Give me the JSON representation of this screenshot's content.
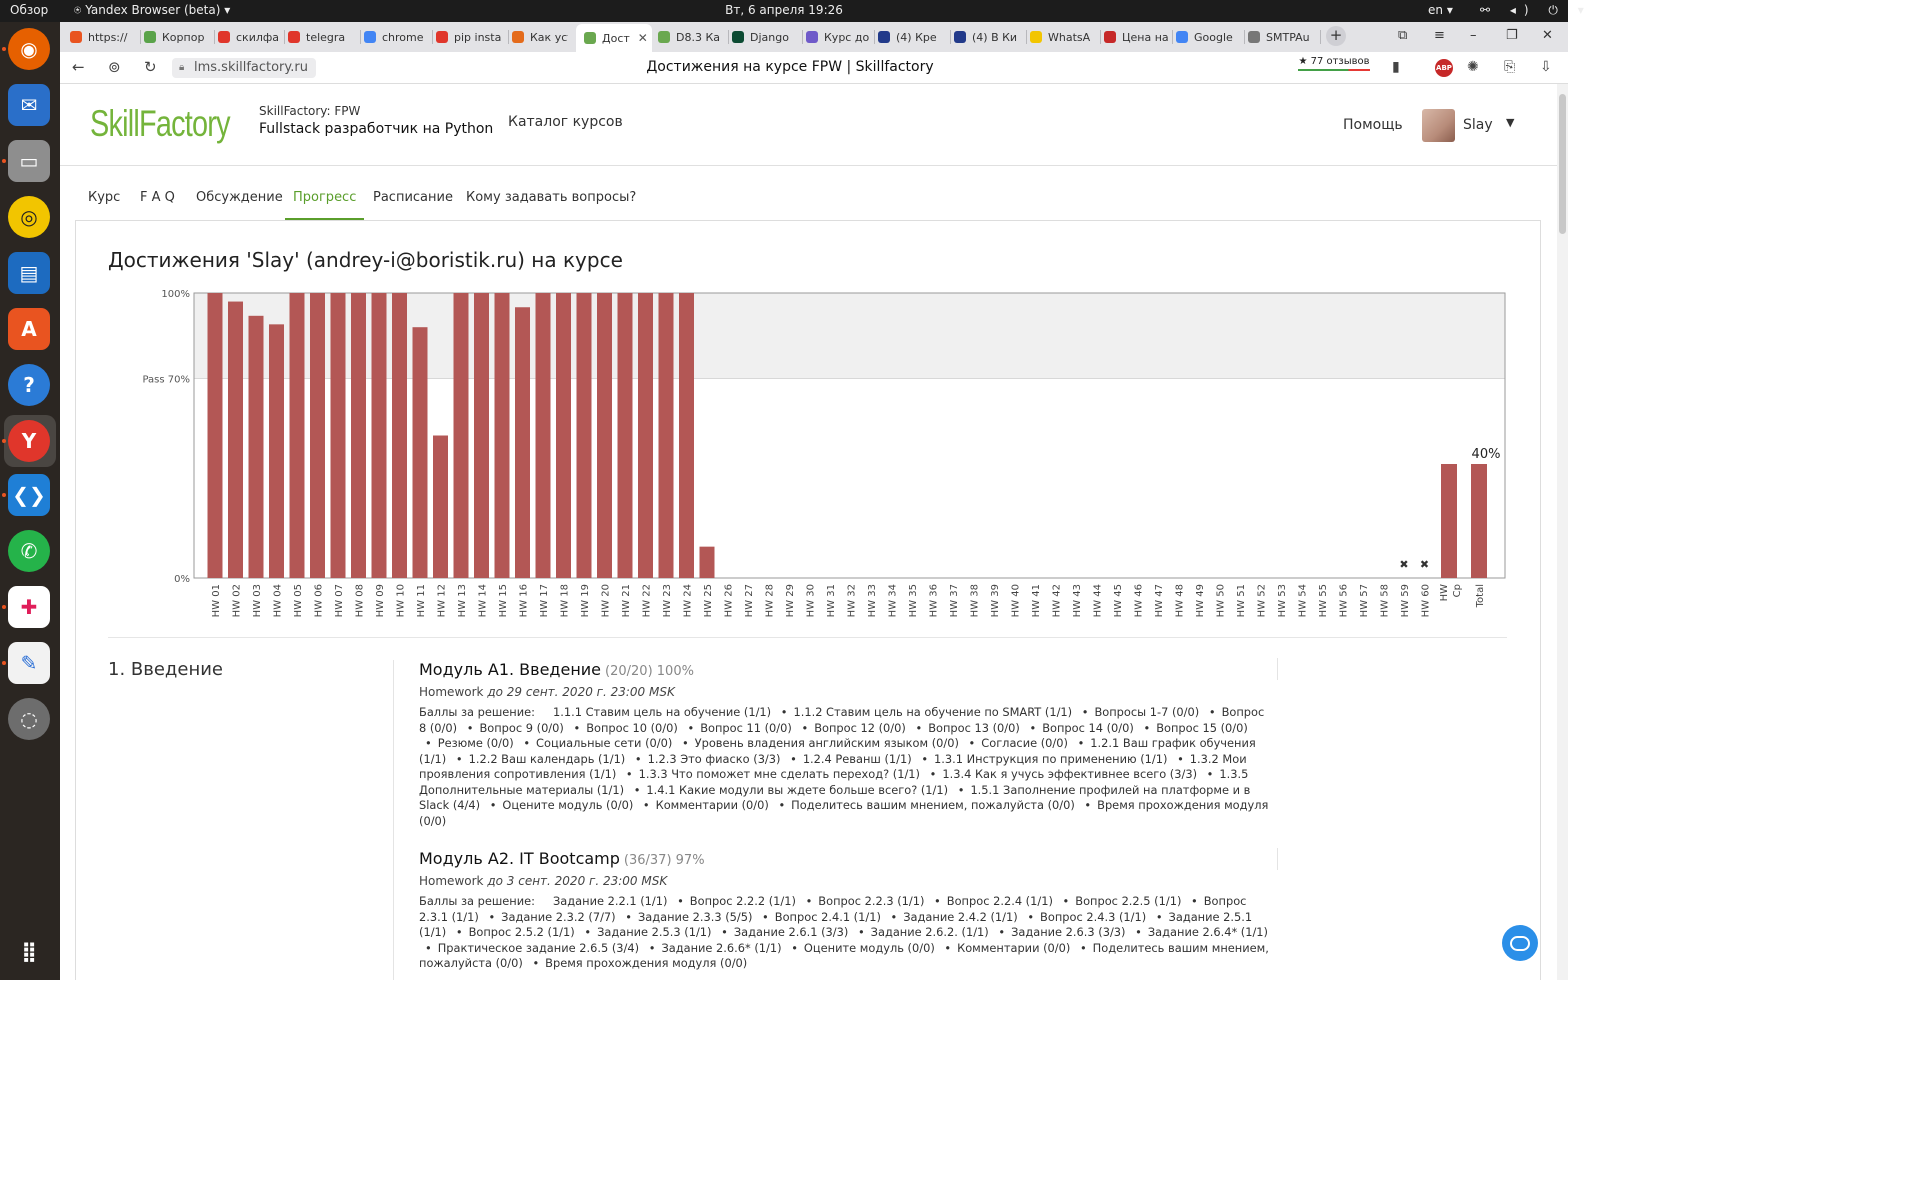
{
  "os": {
    "overview": "Обзор",
    "app_name": "Yandex Browser (beta)",
    "clock": "Вт, 6 апреля  19:26",
    "lang": "en"
  },
  "dock": [
    {
      "name": "firefox-icon",
      "color": "#e66000"
    },
    {
      "name": "thunderbird-icon",
      "color": "#2a6fc9"
    },
    {
      "name": "files-icon",
      "color": "#8e8e8e"
    },
    {
      "name": "rhythmbox-icon",
      "color": "#f2c500"
    },
    {
      "name": "writer-icon",
      "color": "#1d6bc0"
    },
    {
      "name": "software-icon",
      "color": "#e95420"
    },
    {
      "name": "help-icon",
      "color": "#2b7bd6"
    },
    {
      "name": "yandex-browser-icon",
      "color": "#e0362b"
    },
    {
      "name": "vscode-icon",
      "color": "#1f7fd6"
    },
    {
      "name": "whatsapp-icon",
      "color": "#25b34a"
    },
    {
      "name": "slack-icon",
      "color": "#ffffff"
    },
    {
      "name": "text-editor-icon",
      "color": "#f2f2f2"
    },
    {
      "name": "disks-icon",
      "color": "#6d6d6d"
    },
    {
      "name": "apps-grid-icon",
      "color": "#2b2622"
    }
  ],
  "tabs": [
    {
      "label": "https://",
      "color": "#e95420"
    },
    {
      "label": "Корпор",
      "color": "#5aa34a"
    },
    {
      "label": "скилфа",
      "color": "#e0362b"
    },
    {
      "label": "telegra",
      "color": "#e0362b"
    },
    {
      "label": "chrome",
      "color": "#4285f4"
    },
    {
      "label": "pip insta",
      "color": "#e0362b"
    },
    {
      "label": "Как уста",
      "color": "#e46b1b"
    },
    {
      "label": "Дост",
      "color": "#6aa84f"
    },
    {
      "label": "D8.3 Ка",
      "color": "#6aa84f"
    },
    {
      "label": "Django",
      "color": "#0c4b33"
    },
    {
      "label": "Курс до",
      "color": "#6f5ac9"
    },
    {
      "label": "(4) Кре",
      "color": "#223a8a"
    },
    {
      "label": "(4) В Ки",
      "color": "#223a8a"
    },
    {
      "label": "WhatsA",
      "color": "#f2c500"
    },
    {
      "label": "Цена на",
      "color": "#c62828"
    },
    {
      "label": "Google",
      "color": "#4285f4"
    },
    {
      "label": "SMTPAu",
      "color": "#777777"
    }
  ],
  "address": {
    "url": "lms.skillfactory.ru",
    "page_title": "Достижения на курсе FPW | Skillfactory",
    "reviews": "★ 77 отзывов",
    "abp": "ABP"
  },
  "header": {
    "logo": "SkillFactory",
    "course_org": "SkillFactory: FPW",
    "course_name": "Fullstack разработчик на Python",
    "catalog": "Каталог курсов",
    "help": "Помощь",
    "user": "Slay"
  },
  "course_tabs": [
    "Курс",
    "F A Q",
    "Обсуждение",
    "Прогресс",
    "Расписание",
    "Кому задавать вопросы?"
  ],
  "progress": {
    "title": "Достижения 'Slay' (andrey-i@boristik.ru) на курсе"
  },
  "chart_data": {
    "type": "bar",
    "y_ticks": [
      "100%",
      "Pass 70%",
      "0%"
    ],
    "pass_threshold": 0.7,
    "ylim": [
      0,
      1
    ],
    "categories": [
      "HW 01",
      "HW 02",
      "HW 03",
      "HW 04",
      "HW 05",
      "HW 06",
      "HW 07",
      "HW 08",
      "HW 09",
      "HW 10",
      "HW 11",
      "HW 12",
      "HW 13",
      "HW 14",
      "HW 15",
      "HW 16",
      "HW 17",
      "HW 18",
      "HW 19",
      "HW 20",
      "HW 21",
      "HW 22",
      "HW 23",
      "HW 24",
      "HW 25",
      "HW 26",
      "HW 27",
      "HW 28",
      "HW 29",
      "HW 30",
      "HW 31",
      "HW 32",
      "HW 33",
      "HW 34",
      "HW 35",
      "HW 36",
      "HW 37",
      "HW 38",
      "HW 39",
      "HW 40",
      "HW 41",
      "HW 42",
      "HW 43",
      "HW 44",
      "HW 45",
      "HW 46",
      "HW 47",
      "HW 48",
      "HW 49",
      "HW 50",
      "HW 51",
      "HW 52",
      "HW 53",
      "HW 54",
      "HW 55",
      "HW 56",
      "HW 57",
      "HW 58",
      "HW 59",
      "HW 60"
    ],
    "values": [
      1.0,
      0.97,
      0.92,
      0.89,
      1.0,
      1.0,
      1.0,
      1.0,
      1.0,
      1.0,
      0.88,
      0.5,
      1.0,
      1.0,
      1.0,
      0.95,
      1.0,
      1.0,
      1.0,
      1.0,
      1.0,
      1.0,
      1.0,
      1.0,
      0.11,
      0,
      0,
      0,
      0,
      0,
      0,
      0,
      0,
      0,
      0,
      0,
      0,
      0,
      0,
      0,
      0,
      0,
      0,
      0,
      0,
      0,
      0,
      0,
      0,
      0,
      0,
      0,
      0,
      0,
      0,
      0,
      0,
      0,
      0,
      0
    ],
    "dropped": [
      "HW 59",
      "HW 60"
    ],
    "summary_categories": [
      "HW Ср",
      "Total"
    ],
    "summary_values": [
      0.4,
      0.4
    ],
    "total_label": "40%",
    "colors": {
      "bar": "#b35755",
      "pass_zone": "#f0f0f0",
      "border": "#9a9a9a"
    },
    "grid": false
  },
  "sections": {
    "title": "1. Введение",
    "modules": [
      {
        "title": "Модуль А1. Введение",
        "score": "(20/20) 100%",
        "hw_label": "Homework",
        "hw_due": "до 29 сент. 2020 г. 23:00 MSK",
        "items_label": "Баллы за решение:",
        "items": [
          "1.1.1 Ставим цель на обучение (1/1)",
          "1.1.2 Ставим цель на обучение по SMART (1/1)",
          "Вопросы 1-7 (0/0)",
          "Вопрос 8 (0/0)",
          "Вопрос 9 (0/0)",
          "Вопрос 10 (0/0)",
          "Вопрос 11 (0/0)",
          "Вопрос 12 (0/0)",
          "Вопрос 13 (0/0)",
          "Вопрос 14 (0/0)",
          "Вопрос 15 (0/0)",
          "Резюме (0/0)",
          "Социальные сети (0/0)",
          "Уровень владения английским языком (0/0)",
          "Согласие (0/0)",
          "1.2.1 Ваш график обучения (1/1)",
          "1.2.2 Ваш календарь (1/1)",
          "1.2.3 Это фиаско (3/3)",
          "1.2.4 Реванш (1/1)",
          "1.3.1 Инструкция по применению (1/1)",
          "1.3.2 Мои проявления сопротивления (1/1)",
          "1.3.3 Что поможет мне сделать переход? (1/1)",
          "1.3.4 Как я учусь эффективнее всего (3/3)",
          "1.3.5 Дополнительные материалы (1/1)",
          "1.4.1 Какие модули вы ждете больше всего? (1/1)",
          "1.5.1 Заполнение профилей на платформе и в Slack (4/4)",
          "Оцените модуль (0/0)",
          "Комментарии (0/0)",
          "Поделитесь вашим мнением, пожалуйста (0/0)",
          "Время прохождения модуля (0/0)"
        ]
      },
      {
        "title": "Модуль А2. IT Bootcamp",
        "score": "(36/37) 97%",
        "hw_label": "Homework",
        "hw_due": "до 3 сент. 2020 г. 23:00 MSK",
        "items_label": "Баллы за решение:",
        "items": [
          "Задание 2.2.1 (1/1)",
          "Вопрос 2.2.2 (1/1)",
          "Вопрос 2.2.3 (1/1)",
          "Вопрос 2.2.4 (1/1)",
          "Вопрос 2.2.5 (1/1)",
          "Вопрос 2.3.1 (1/1)",
          "Задание 2.3.2 (7/7)",
          "Задание 2.3.3 (5/5)",
          "Вопрос 2.4.1 (1/1)",
          "Задание 2.4.2 (1/1)",
          "Вопрос 2.4.3 (1/1)",
          "Задание 2.5.1 (1/1)",
          "Вопрос 2.5.2 (1/1)",
          "Задание 2.5.3 (1/1)",
          "Задание 2.6.1 (3/3)",
          "Задание 2.6.2. (1/1)",
          "Задание 2.6.3 (3/3)",
          "Задание 2.6.4* (1/1)",
          "Практическое задание 2.6.5 (3/4)",
          "Задание 2.6.6* (1/1)",
          "Оцените модуль (0/0)",
          "Комментарии (0/0)",
          "Поделитесь вашим мнением, пожалуйста (0/0)",
          "Время прохождения модуля (0/0)"
        ]
      }
    ]
  }
}
